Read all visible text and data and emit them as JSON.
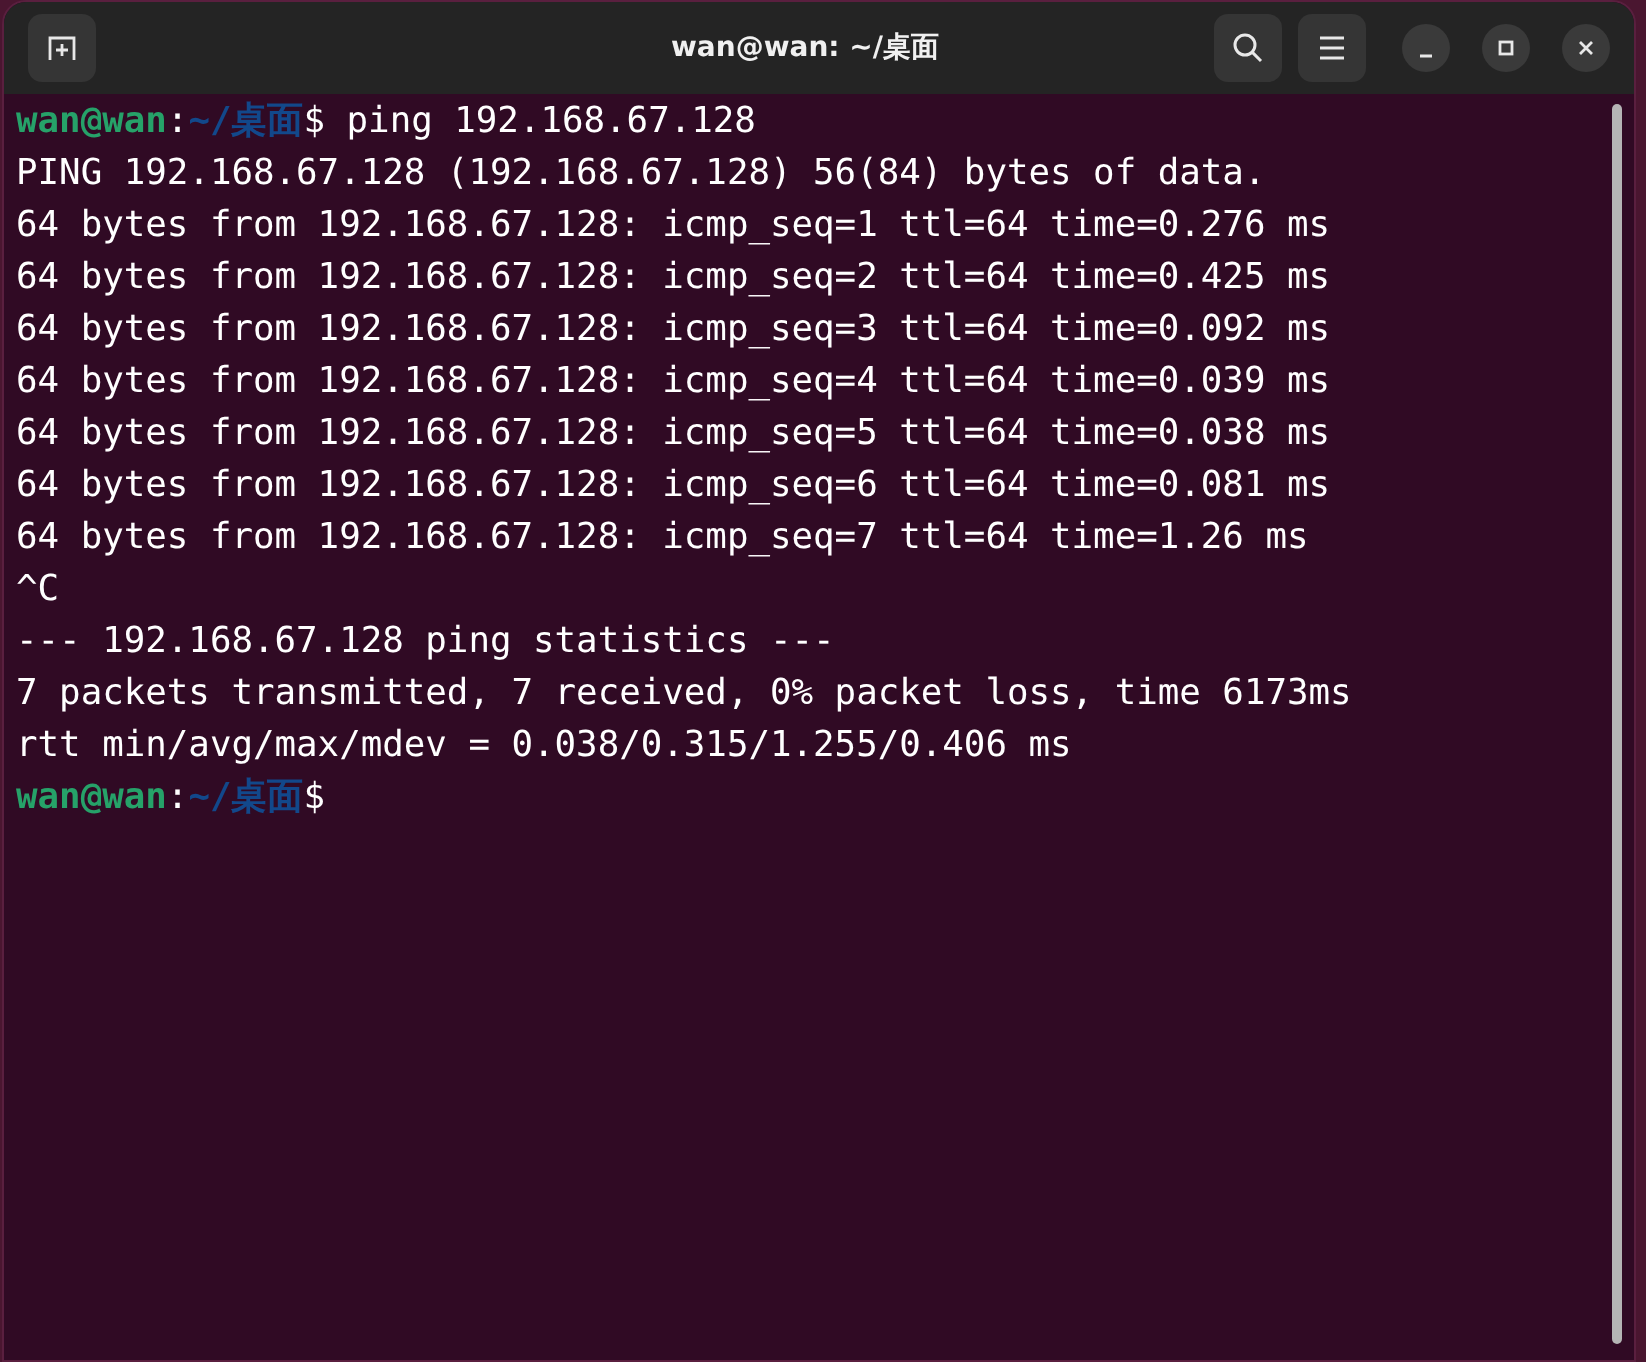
{
  "window": {
    "title": "wan@wan: ~/桌面"
  },
  "terminal": {
    "lines": [
      {
        "kind": "prompt",
        "segments": [
          {
            "text": "wan@wan",
            "color": "#26a269"
          },
          {
            "text": ":",
            "color": "#ffffff"
          },
          {
            "text": "~/桌面",
            "color": "#12488b"
          },
          {
            "text": "$ ping 192.168.67.128",
            "color": "#ffffff"
          }
        ]
      },
      {
        "kind": "output",
        "text": "PING 192.168.67.128 (192.168.67.128) 56(84) bytes of data."
      },
      {
        "kind": "output",
        "text": "64 bytes from 192.168.67.128: icmp_seq=1 ttl=64 time=0.276 ms"
      },
      {
        "kind": "output",
        "text": "64 bytes from 192.168.67.128: icmp_seq=2 ttl=64 time=0.425 ms"
      },
      {
        "kind": "output",
        "text": "64 bytes from 192.168.67.128: icmp_seq=3 ttl=64 time=0.092 ms"
      },
      {
        "kind": "output",
        "text": "64 bytes from 192.168.67.128: icmp_seq=4 ttl=64 time=0.039 ms"
      },
      {
        "kind": "output",
        "text": "64 bytes from 192.168.67.128: icmp_seq=5 ttl=64 time=0.038 ms"
      },
      {
        "kind": "output",
        "text": "64 bytes from 192.168.67.128: icmp_seq=6 ttl=64 time=0.081 ms"
      },
      {
        "kind": "output",
        "text": "64 bytes from 192.168.67.128: icmp_seq=7 ttl=64 time=1.26 ms"
      },
      {
        "kind": "output",
        "text": "^C"
      },
      {
        "kind": "output",
        "text": "--- 192.168.67.128 ping statistics ---"
      },
      {
        "kind": "output",
        "text": "7 packets transmitted, 7 received, 0% packet loss, time 6173ms"
      },
      {
        "kind": "output",
        "text": "rtt min/avg/max/mdev = 0.038/0.315/1.255/0.406 ms"
      },
      {
        "kind": "prompt",
        "segments": [
          {
            "text": "wan@wan",
            "color": "#26a269"
          },
          {
            "text": ":",
            "color": "#ffffff"
          },
          {
            "text": "~/桌面",
            "color": "#12488b"
          },
          {
            "text": "$",
            "color": "#ffffff"
          }
        ]
      }
    ]
  }
}
